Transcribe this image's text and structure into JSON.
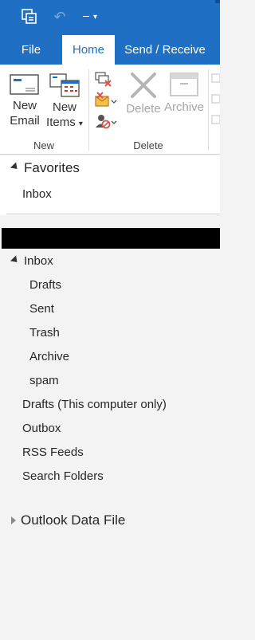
{
  "title_bar": {
    "icons": [
      "sync-icon",
      "undo-icon",
      "customize-quick-access-icon"
    ],
    "undo_glyph": "↶",
    "qa_glyph": "▾"
  },
  "tabs": [
    {
      "label": "File"
    },
    {
      "label": "Home",
      "active": true
    },
    {
      "label": "Send / Receive"
    }
  ],
  "ribbon": {
    "new_email": {
      "line1": "New",
      "line2": "Email"
    },
    "new_items": {
      "line1": "New",
      "line2": "Items",
      "dropdown": "▾"
    },
    "delete": {
      "label": "Delete"
    },
    "archive": {
      "label": "Archive"
    },
    "groups": {
      "new": "New",
      "delete": "Delete"
    },
    "small_icons": [
      "ignore-icon",
      "clean-up-icon",
      "junk-icon"
    ],
    "dropdown_glyph": "▾",
    "collapse_glyph": "◂"
  },
  "favorites": {
    "title": "Favorites",
    "items": [
      {
        "label": "Inbox"
      }
    ]
  },
  "account": {
    "inbox": "Inbox",
    "subfolders": [
      {
        "label": "Drafts"
      },
      {
        "label": "Sent"
      },
      {
        "label": "Trash"
      },
      {
        "label": "Archive"
      },
      {
        "label": "spam"
      }
    ],
    "folders": [
      {
        "label": "Drafts (This computer only)"
      },
      {
        "label": "Outbox"
      },
      {
        "label": "RSS Feeds"
      },
      {
        "label": "Search Folders"
      }
    ]
  },
  "data_file": {
    "title": "Outlook Data File"
  },
  "colors": {
    "accent": "#1f6fc5",
    "ribbon_bg": "#ffffff",
    "pane_bg": "#f3f3f3",
    "disabled_text": "#a6a6a6",
    "account_bar": "#000000"
  }
}
